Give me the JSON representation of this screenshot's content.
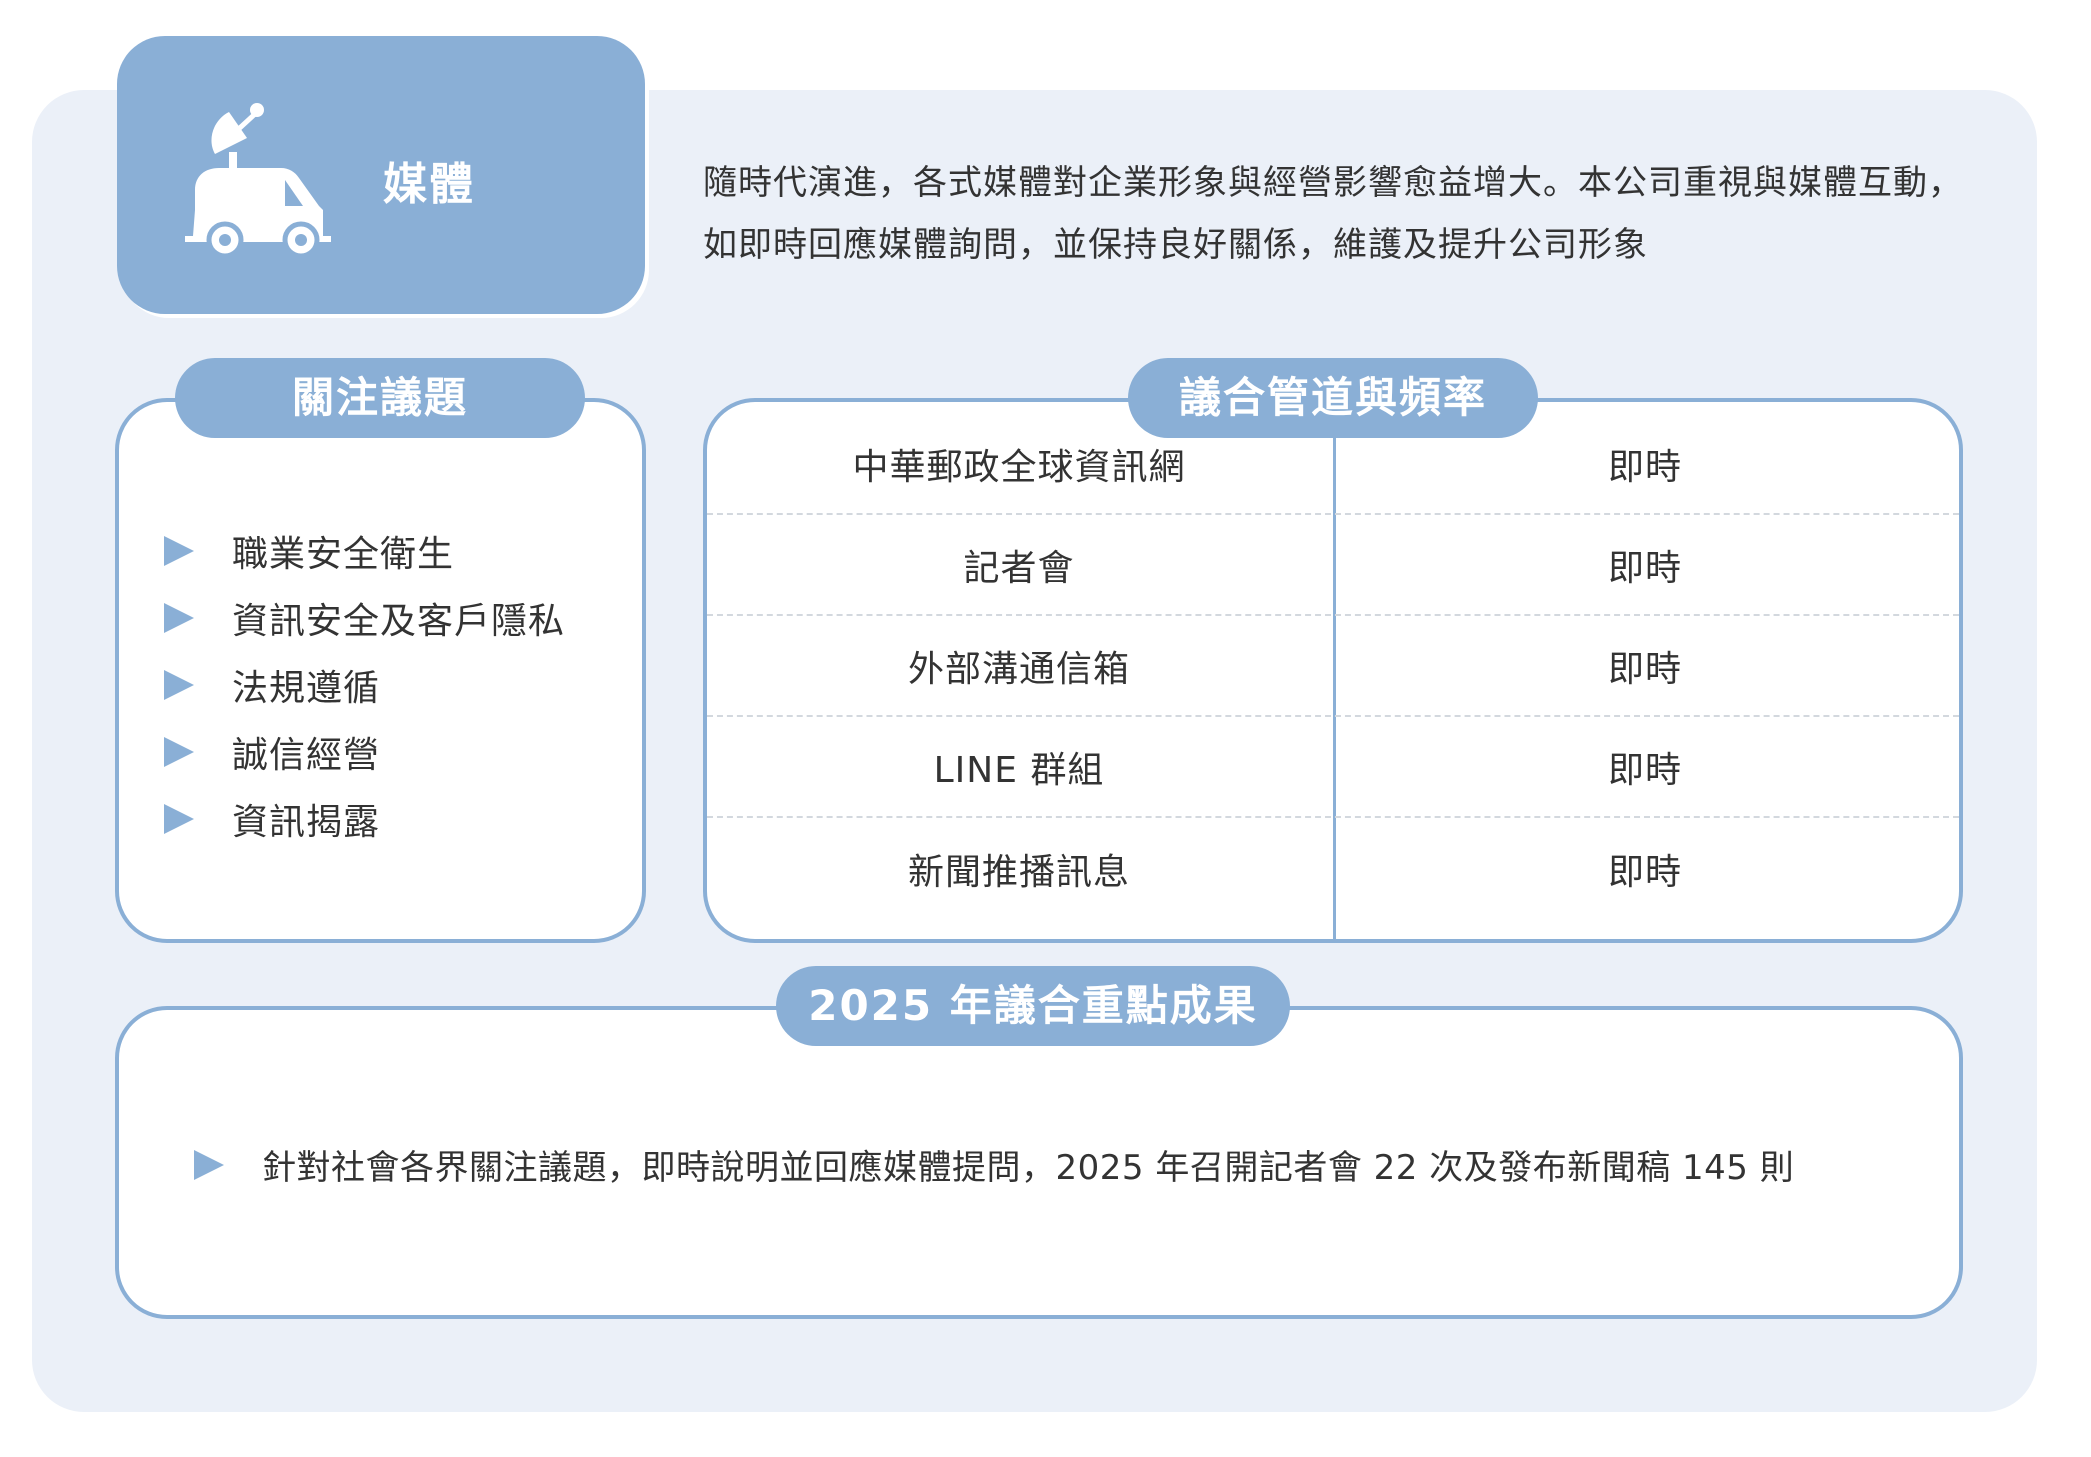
{
  "header": {
    "title": "媒體",
    "icon": "satellite-van-icon",
    "description": "隨時代演進，各式媒體對企業形象與經營影響愈益增大。本公司重視與媒體互動，如即時回應媒體詢問，並保持良好關係，維護及提升公司形象"
  },
  "topics": {
    "title": "關注議題",
    "items": [
      "職業安全衛生",
      "資訊安全及客戶隱私",
      "法規遵循",
      "誠信經營",
      "資訊揭露"
    ]
  },
  "channels": {
    "title": "議合管道與頻率",
    "rows": [
      {
        "channel": "中華郵政全球資訊網",
        "frequency": "即時"
      },
      {
        "channel": "記者會",
        "frequency": "即時"
      },
      {
        "channel": "外部溝通信箱",
        "frequency": "即時"
      },
      {
        "channel": "LINE 群組",
        "frequency": "即時"
      },
      {
        "channel": "新聞推播訊息",
        "frequency": "即時"
      }
    ]
  },
  "results": {
    "title": "2025 年議合重點成果",
    "items": [
      "針對社會各界關注議題，即時說明並回應媒體提問，2025 年召開記者會 22 次及發布新聞稿 145 則"
    ]
  },
  "colors": {
    "accent": "#8aafd6",
    "panel": "#ebf0f8",
    "text": "#333333"
  }
}
